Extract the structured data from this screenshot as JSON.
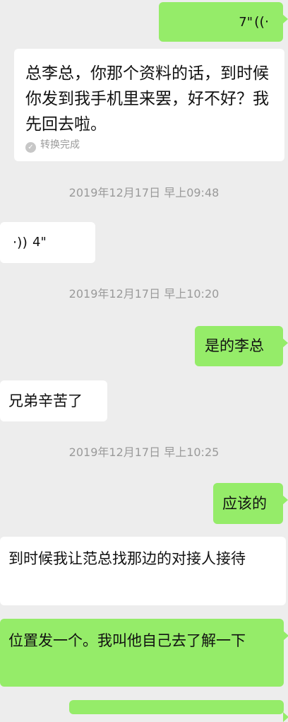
{
  "messages": [
    {
      "type": "voice",
      "side": "out",
      "duration": "7\"",
      "icon_name": "voice-wave-icon"
    },
    {
      "type": "text",
      "side": "in",
      "text": "总李总，你那个资料的话，到时候你发到我手机里来罢，好不好？我先回去啦。",
      "status": "转换完成",
      "status_icon": "check-circle-icon"
    },
    {
      "type": "timestamp",
      "text": "2019年12月17日 早上09:48"
    },
    {
      "type": "voice",
      "side": "in",
      "duration": "4\"",
      "icon_name": "voice-wave-icon"
    },
    {
      "type": "timestamp",
      "text": "2019年12月17日 早上10:20"
    },
    {
      "type": "text",
      "side": "out",
      "text": "是的李总"
    },
    {
      "type": "text",
      "side": "in",
      "text": "兄弟辛苦了"
    },
    {
      "type": "timestamp",
      "text": "2019年12月17日 早上10:25"
    },
    {
      "type": "text",
      "side": "out",
      "text": "应该的"
    },
    {
      "type": "text",
      "side": "in",
      "text": "到时候我让范总找那边的对接人接待"
    },
    {
      "type": "text",
      "side": "out",
      "text": "位置发一个。我叫他自己去了解一下"
    }
  ],
  "colors": {
    "background": "#ededed",
    "outgoing_bubble": "#95ec69",
    "incoming_bubble": "#ffffff",
    "timestamp_text": "#9a9a9a"
  }
}
